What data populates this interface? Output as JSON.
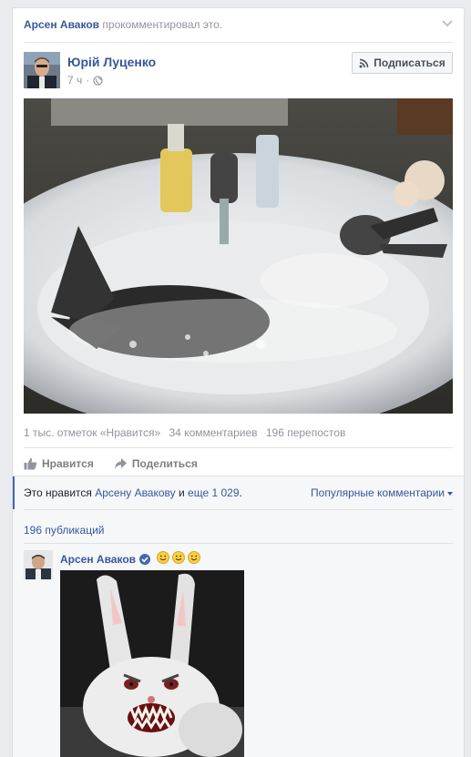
{
  "story": {
    "actor": "Арсен Аваков",
    "action": "прокомментировал это."
  },
  "post": {
    "author": "Юрій Луценко",
    "time": "7 ч",
    "subscribe_label": "Подписаться"
  },
  "stats": {
    "likes": "1 тыс. отметок «Нравится»",
    "comments": "34 комментариев",
    "shares": "196 перепостов"
  },
  "actions": {
    "like": "Нравится",
    "share": "Поделиться"
  },
  "likes_row": {
    "prefix": "Это нравится",
    "liker": "Арсену Авакову",
    "conj": "и",
    "others": "еще 1 029",
    "period": ".",
    "sort_label": "Популярные комментарии"
  },
  "publications": "196 публикаций",
  "comment": {
    "author": "Арсен Аваков",
    "emoji_count": 3
  },
  "colors": {
    "link": "#365899",
    "meta": "#90949c",
    "accent": "#4267b2",
    "background": "#e9ebee"
  },
  "icons": [
    "chevron-down-icon",
    "globe-icon",
    "rss-icon",
    "like-icon",
    "share-icon",
    "verified-icon",
    "smiley-icon"
  ]
}
